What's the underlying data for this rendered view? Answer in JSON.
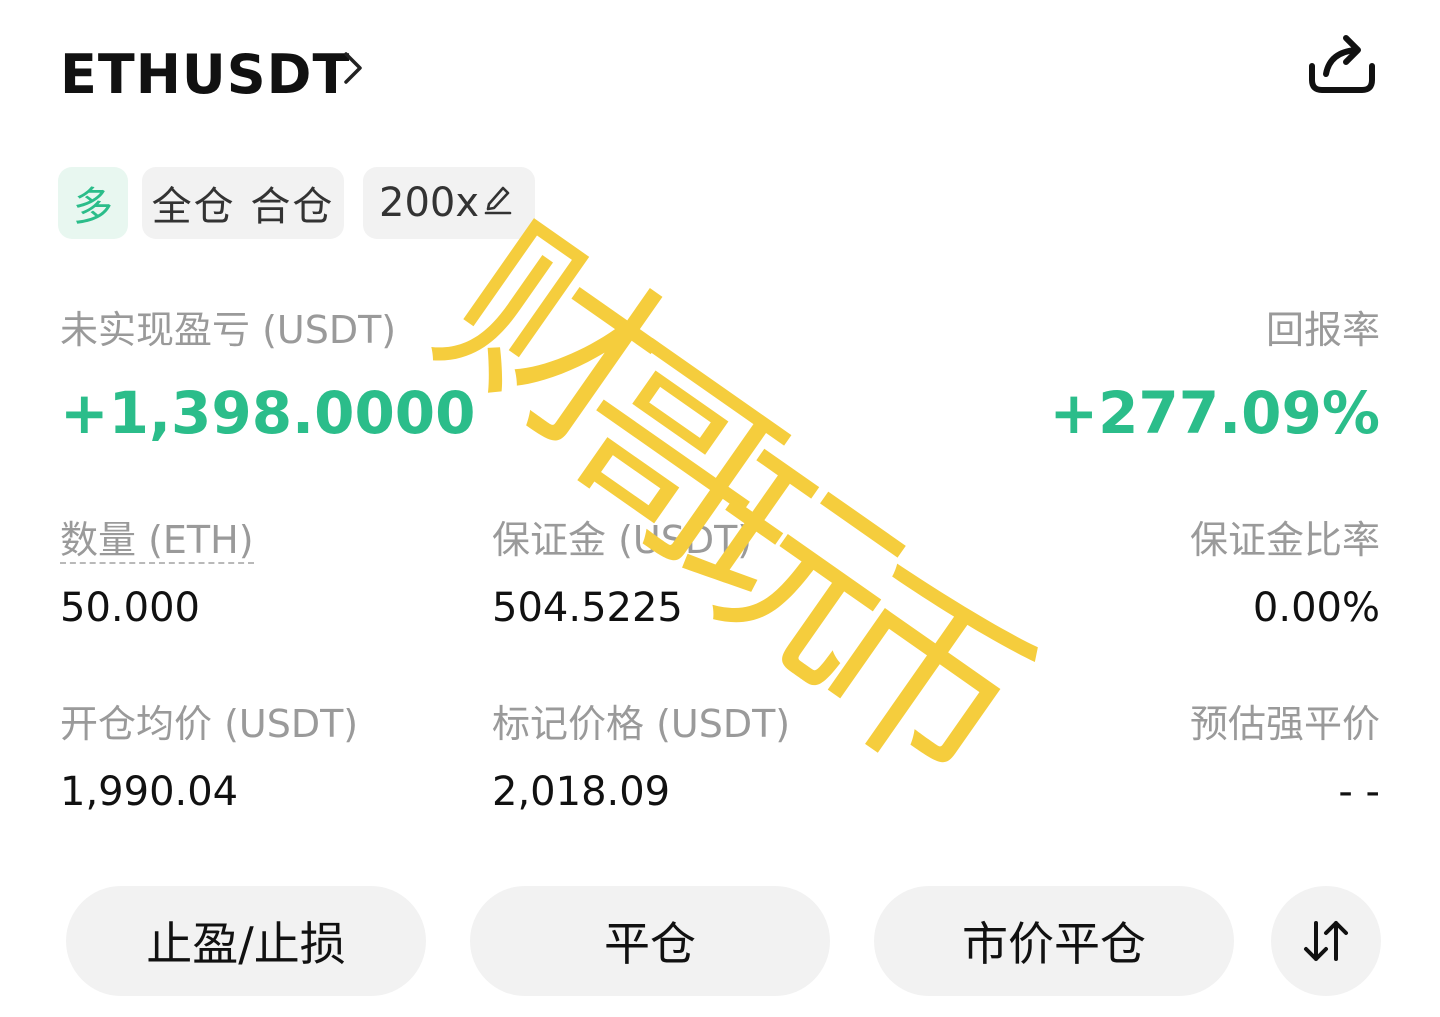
{
  "header": {
    "symbol": "ETHUSDT",
    "chevron_icon": "chevron-right-icon",
    "share_icon": "share-icon"
  },
  "tags": {
    "side": "多",
    "margin_mode": "全仓 合仓",
    "leverage": "200x",
    "edit_icon": "pencil-icon"
  },
  "pnl": {
    "label": "未实现盈亏 (USDT)",
    "value": "+1,398.0000"
  },
  "roe": {
    "label": "回报率",
    "value": "+277.09%"
  },
  "stats": {
    "quantity_label": "数量 (ETH)",
    "quantity_value": "50.000",
    "margin_label": "保证金 (USDT)",
    "margin_value": "504.5225",
    "margin_ratio_label": "保证金比率",
    "margin_ratio_value": "0.00%",
    "entry_price_label": "开仓均价 (USDT)",
    "entry_price_value": "1,990.04",
    "mark_price_label": "标记价格 (USDT)",
    "mark_price_value": "2,018.09",
    "liq_price_label": "预估强平价",
    "liq_price_value": "- -"
  },
  "buttons": {
    "tpsl": "止盈/止损",
    "close": "平仓",
    "market_close": "市价平仓",
    "swap_icon": "swap-arrows-icon"
  },
  "watermark": {
    "chars": [
      "财",
      "哥",
      "玩",
      "币"
    ]
  },
  "colors": {
    "green": "#2bbd8a",
    "watermark": "#f5cd3d",
    "label_gray": "#9a9a9a",
    "chip_bg": "#f2f2f2"
  }
}
